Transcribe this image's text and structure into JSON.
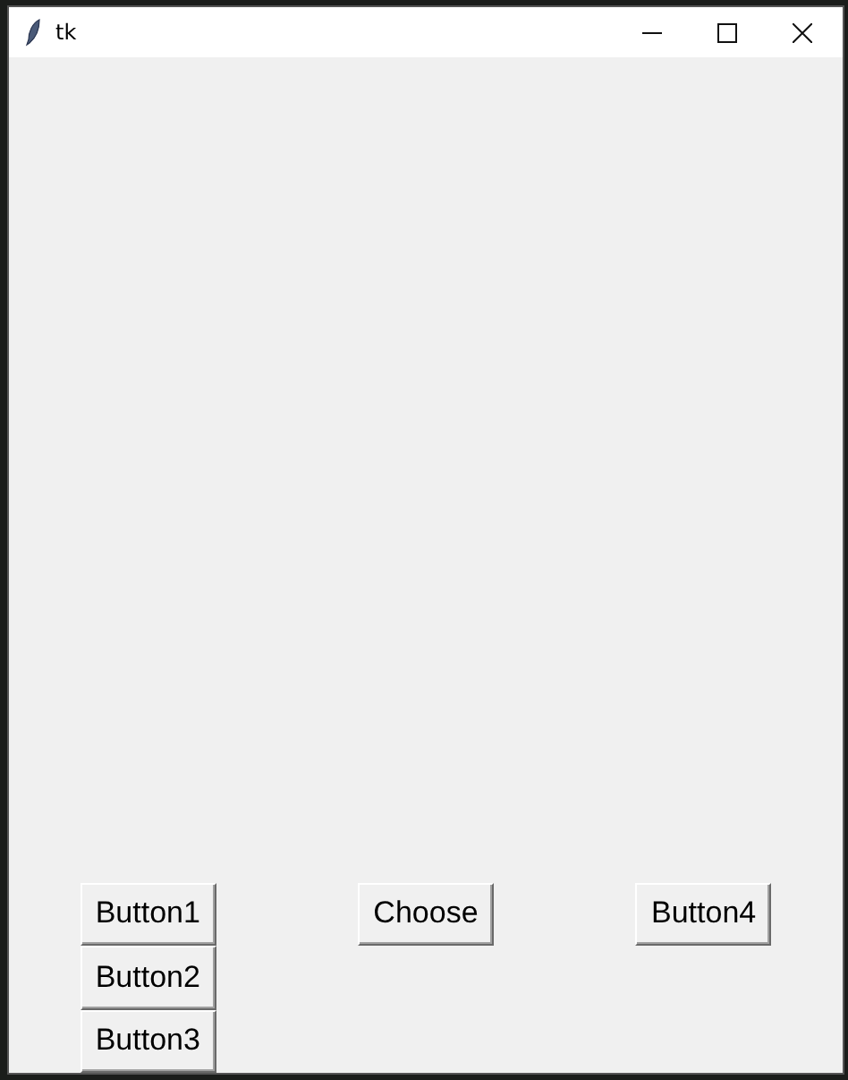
{
  "window": {
    "title": "tk"
  },
  "button_rows": [
    [
      "Button1",
      "Choose",
      "Button4"
    ],
    [
      "Button2"
    ],
    [
      "Button3"
    ]
  ]
}
